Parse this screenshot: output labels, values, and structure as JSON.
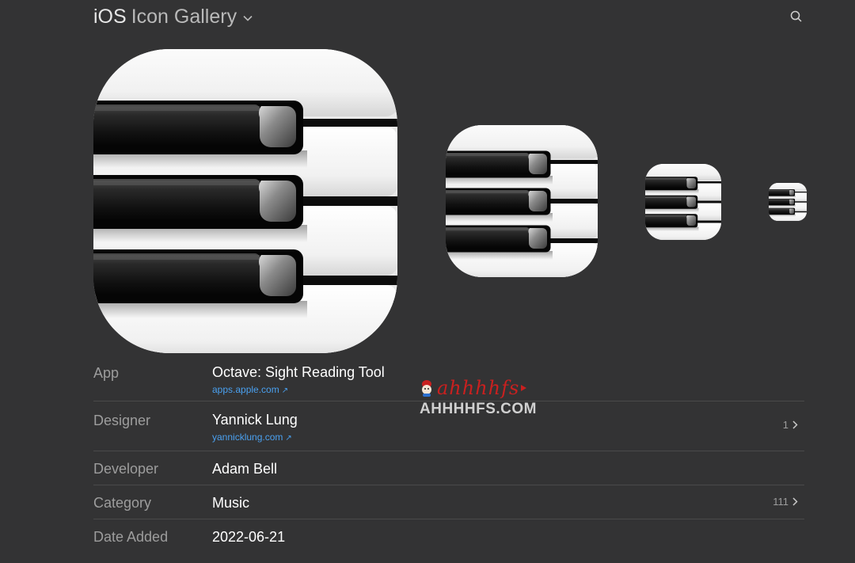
{
  "header": {
    "brand_strong": "iOS",
    "brand_light": "Icon Gallery",
    "menu_icon": "chevron-down-icon",
    "search_icon": "search-icon"
  },
  "icons": {
    "subject": "piano-keys",
    "sizes": [
      "large",
      "medium",
      "small",
      "tiny"
    ]
  },
  "details": {
    "app": {
      "label": "App",
      "value": "Octave: Sight Reading Tool",
      "link": "apps.apple.com",
      "link_icon": "external-link-icon"
    },
    "designer": {
      "label": "Designer",
      "value": "Yannick Lung",
      "link": "yannicklung.com",
      "link_icon": "external-link-icon",
      "count": "1"
    },
    "developer": {
      "label": "Developer",
      "value": "Adam Bell"
    },
    "category": {
      "label": "Category",
      "value": "Music",
      "count": "111"
    },
    "date_added": {
      "label": "Date Added",
      "value": "2022-06-21"
    }
  },
  "watermark": {
    "script": "ahhhhfs",
    "text": "AHHHHFS.COM"
  },
  "colors": {
    "background": "#333334",
    "link": "#4aa0ef",
    "label": "#9d9d9d",
    "value": "#ffffff",
    "watermark_red": "#c9201f"
  }
}
